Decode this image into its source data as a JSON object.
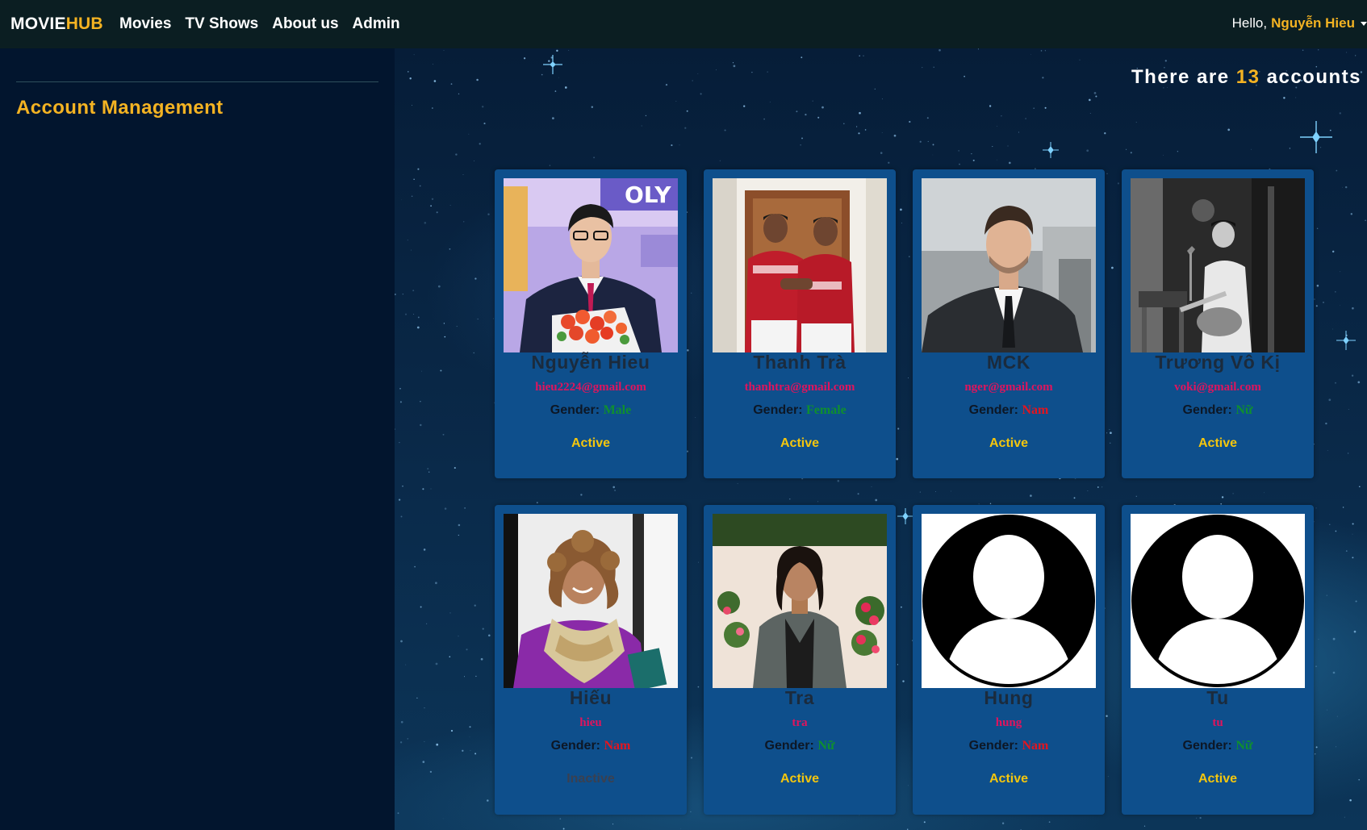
{
  "nav": {
    "brand_part1": "MOVIE",
    "brand_part2": "HUB",
    "links": [
      "Movies",
      "TV Shows",
      "About us",
      "Admin"
    ],
    "greeting": "Hello,",
    "user_name": "Nguyễn Hieu"
  },
  "sidebar": {
    "section_title": "Account Management"
  },
  "summary": {
    "prefix": "There are",
    "count": "13",
    "suffix": "accounts"
  },
  "gender_label": "Gender:",
  "accounts": [
    {
      "name": "Nguyễn Hieu",
      "email": "hieu2224@gmail.com",
      "gender": "Male",
      "gender_color": "#0f8f2f",
      "status": "Active",
      "avatar": "photo-man-flowers"
    },
    {
      "name": "Thanh Trà",
      "email": "thanhtra@gmail.com",
      "gender": "Female",
      "gender_color": "#0f8f2f",
      "status": "Active",
      "avatar": "photo-two-players"
    },
    {
      "name": "MCK",
      "email": "nger@gmail.com",
      "gender": "Nam",
      "gender_color": "#e4151f",
      "status": "Active",
      "avatar": "photo-man-suit"
    },
    {
      "name": "Trương Vô Kị",
      "email": "voki@gmail.com",
      "gender": "Nữ",
      "gender_color": "#0f8f2f",
      "status": "Active",
      "avatar": "photo-guitarist"
    },
    {
      "name": "Hiếu",
      "email": "hieu",
      "gender": "Nam",
      "gender_color": "#e4151f",
      "status": "Inactive",
      "avatar": "photo-woman-scarf"
    },
    {
      "name": "Tra",
      "email": "tra",
      "gender": "Nữ",
      "gender_color": "#0f8f2f",
      "status": "Active",
      "avatar": "photo-woman-flowers"
    },
    {
      "name": "Hung",
      "email": "hung",
      "gender": "Nam",
      "gender_color": "#e4151f",
      "status": "Active",
      "avatar": "default-avatar-icon"
    },
    {
      "name": "Tu",
      "email": "tu",
      "gender": "Nữ",
      "gender_color": "#0f8f2f",
      "status": "Active",
      "avatar": "default-avatar-icon"
    }
  ],
  "colors": {
    "accent": "#f4b322",
    "navbar": "#0b1e22",
    "sidebar": "#02152e",
    "card": "#0e4f8c",
    "email": "#e0145d",
    "status_active": "#f4c60e",
    "status_inactive": "#3a4050"
  }
}
